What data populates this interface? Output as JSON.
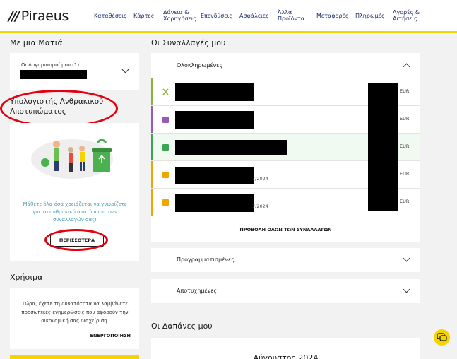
{
  "brand": {
    "logo_mark": "///",
    "logo_text": "Piraeus",
    "accent": "#f0d700",
    "alert_red": "#e3000f"
  },
  "nav": [
    "Καταθέσεις",
    "Κάρτες",
    "Δάνεια &",
    "Χορηγήσεις",
    "Επενδύσεις",
    "Ασφάλειες",
    "Άλλα",
    "Προϊόντα",
    "Μεταφορές",
    "Πληρωμές",
    "Αγορές &",
    "Αιτήσεις"
  ],
  "left": {
    "glance_title": "Με μια Ματιά",
    "accounts_label": "Οι Λογαριασμοί μου (1)",
    "carbon_title": "Υπολογιστής Ανθρακικού Αποτυπώματος",
    "carbon_text": "Μάθετε όλα όσα χρειάζεται να γνωρίζετε για το ανθρακικό αποτύπωμα των συναλλαγών σας!",
    "carbon_button": "ΠΕΡΙΣΣΟΤΕΡΑ",
    "useful_title": "Χρήσιμα",
    "useful_text": "Τώρα, έχετε τη δυνατότητα να λαμβάνετε προσωπικές ενημερώσεις που αφορούν την οικονομική σας διαχείριση.",
    "useful_action": "ΕΝΕΡΓΟΠΟΙΗΣΗ"
  },
  "transactions": {
    "title": "Οι Συναλλαγές μου",
    "completed_label": "Ολοκληρωμένες",
    "rows": [
      {
        "icon": "fork-knife-icon",
        "color": "#8cb43c",
        "currency": "EUR",
        "date": ""
      },
      {
        "icon": "receipt-icon",
        "color": "#9b59b6",
        "currency": "EUR",
        "date": ""
      },
      {
        "icon": "download-icon",
        "color": "#3aa655",
        "currency": "EUR",
        "date": ""
      },
      {
        "icon": "wallet-icon",
        "color": "#f0a500",
        "currency": "EUR",
        "date": "7/2024"
      },
      {
        "icon": "wallet-icon",
        "color": "#f0a500",
        "currency": "EUR",
        "date": "7/2024"
      }
    ],
    "view_all": "ΠΡΟΒΟΛΗ ΟΛΩΝ ΤΩΝ ΣΥΝΑΛΛΑΓΩΝ",
    "scheduled_label": "Προγραμματισμένες",
    "failed_label": "Αποτυχημένες"
  },
  "expenses": {
    "title": "Οι Δαπάνες μου",
    "month": "Αύγουστος 2024"
  }
}
